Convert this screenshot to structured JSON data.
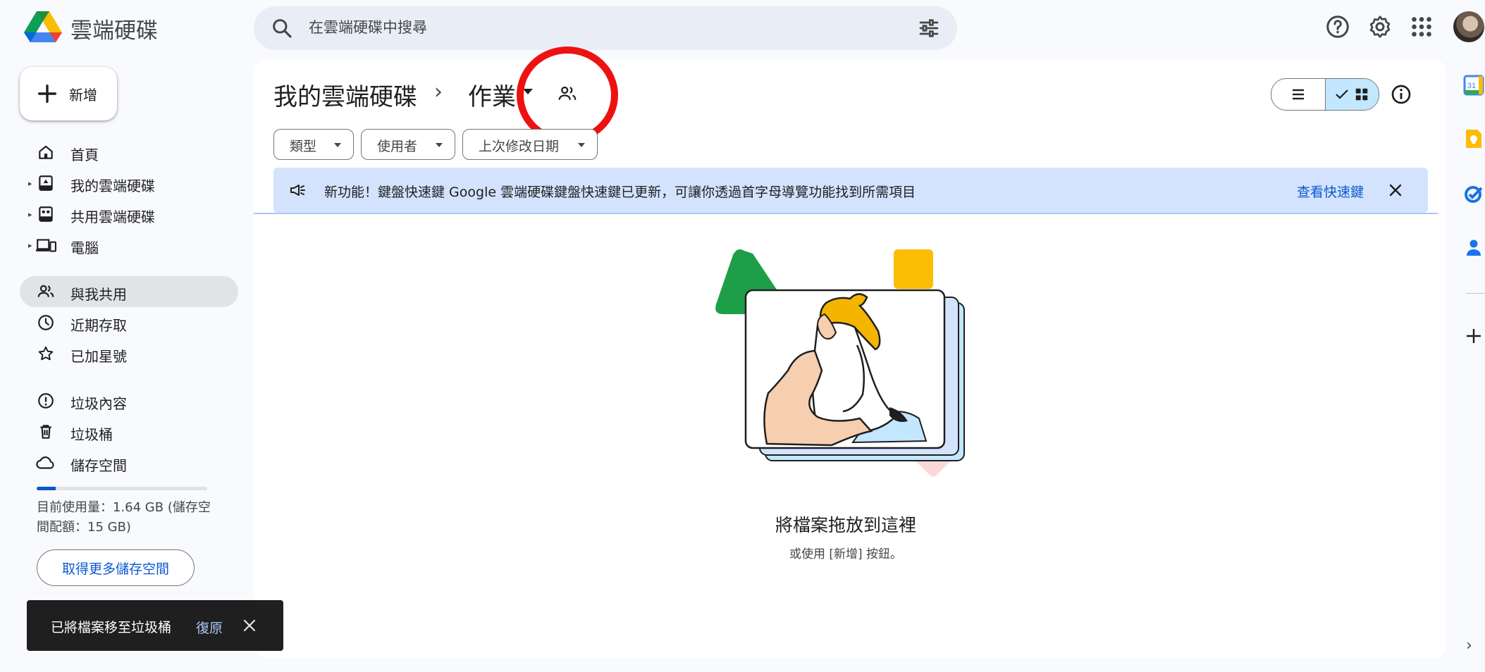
{
  "app": {
    "title": "雲端硬碟"
  },
  "search": {
    "placeholder": "在雲端硬碟中搜尋"
  },
  "new_button": {
    "label": "新增"
  },
  "sidebar": {
    "items": [
      {
        "label": "首頁",
        "icon": "home-icon"
      },
      {
        "label": "我的雲端硬碟",
        "icon": "my-drive-icon"
      },
      {
        "label": "共用雲端硬碟",
        "icon": "shared-drives-icon"
      },
      {
        "label": "電腦",
        "icon": "computer-icon"
      },
      {
        "label": "與我共用",
        "icon": "shared-with-me-icon",
        "active": true
      },
      {
        "label": "近期存取",
        "icon": "clock-icon"
      },
      {
        "label": "已加星號",
        "icon": "star-icon"
      },
      {
        "label": "垃圾內容",
        "icon": "spam-icon"
      },
      {
        "label": "垃圾桶",
        "icon": "trash-icon"
      },
      {
        "label": "儲存空間",
        "icon": "cloud-icon"
      }
    ]
  },
  "storage": {
    "used_fraction": 0.11,
    "text": "目前使用量：1.64 GB (儲存空間配額：15 GB)",
    "cta": "取得更多儲存空間"
  },
  "breadcrumb": {
    "root": "我的雲端硬碟",
    "separator": "›",
    "current": "作業"
  },
  "filters": [
    {
      "label": "類型"
    },
    {
      "label": "使用者"
    },
    {
      "label": "上次修改日期"
    }
  ],
  "banner": {
    "text": "新功能！鍵盤快速鍵 Google 雲端硬碟鍵盤快速鍵已更新，可讓你透過首字母導覽功能找到所需項目",
    "link": "查看快速鍵"
  },
  "empty_state": {
    "title": "將檔案拖放到這裡",
    "subtitle": "或使用 [新增] 按鈕。"
  },
  "snackbar": {
    "text": "已將檔案移至垃圾桶",
    "action": "復原"
  },
  "side_panel": {
    "calendar_day": "31"
  },
  "colors": {
    "accent": "#0b57d0",
    "selected": "#c2e7ff",
    "banner_bg": "#d3e3fd",
    "annotation": "#ee1111"
  }
}
